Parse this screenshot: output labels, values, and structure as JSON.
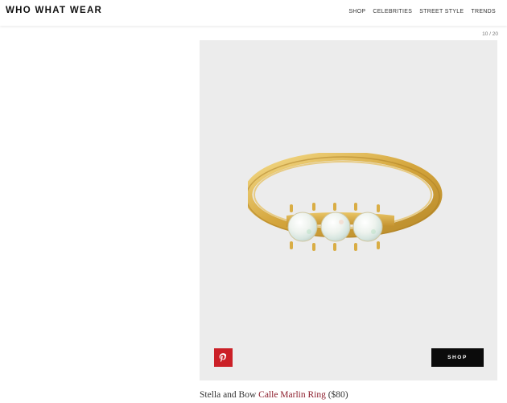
{
  "header": {
    "logo": "WHO WHAT WEAR",
    "nav": [
      "SHOP",
      "CELEBRITIES",
      "STREET STYLE",
      "TRENDS"
    ]
  },
  "gallery": {
    "counter": "10 / 20",
    "image_icon": "gold-opal-ring",
    "pin_icon": "pinterest-icon",
    "pin_color": "#cb2027",
    "shop_label": "SHOP"
  },
  "caption": {
    "brand": "Stella and Bow",
    "product_link": "Calle Marlin Ring",
    "price": "($80)",
    "link_color": "#8c1c2b"
  }
}
